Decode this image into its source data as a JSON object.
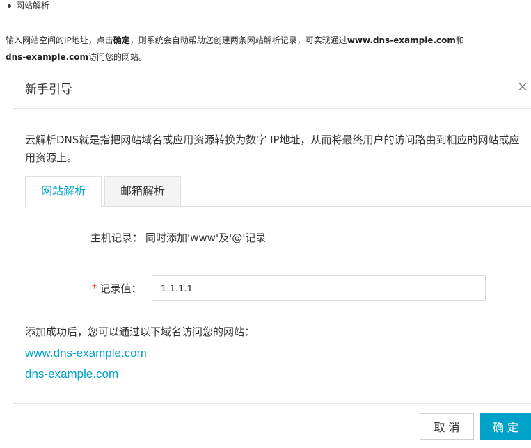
{
  "doc": {
    "bullet_title": "网站解析",
    "intro_part1": "输入网站空间的IP地址，点击",
    "intro_bold_confirm": "确定",
    "intro_part2": "，则系统会自动帮助您创建两条网站解析记录，可实现通过",
    "intro_bold_domain1": "www.dns-example.com",
    "intro_part3": "和",
    "intro_bold_domain2": "dns-example.com",
    "intro_part4": "访问您的网站。"
  },
  "dialog": {
    "title": "新手引导",
    "close_glyph": "×",
    "description": "云解析DNS就是指把网站域名或应用资源转换为数字 IP地址，从而将最终用户的访问路由到相应的网站或应用资源上。",
    "tabs": [
      {
        "label": "网站解析",
        "active": true
      },
      {
        "label": "邮箱解析",
        "active": false
      }
    ],
    "host_record_label": "主机记录：",
    "host_record_value": "同时添加'www'及'@'记录",
    "record_value_label": "记录值：",
    "required_mark": "*",
    "record_value_input": "1.1.1.1",
    "success_text": "添加成功后，您可以通过以下域名访问您的网站：",
    "links": [
      "www.dns-example.com",
      "dns-example.com"
    ],
    "cancel_label": "取 消",
    "ok_label": "确 定"
  },
  "colors": {
    "accent": "#00a2ca",
    "required": "#e4393c"
  }
}
